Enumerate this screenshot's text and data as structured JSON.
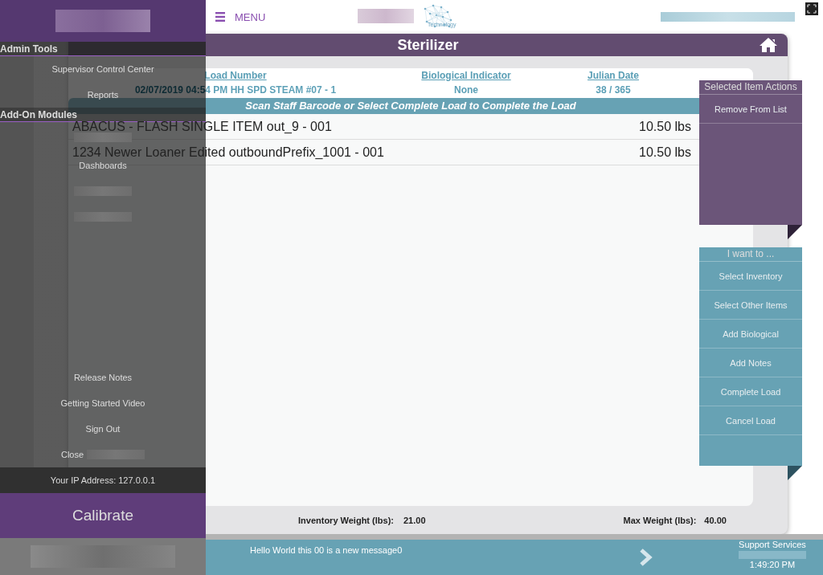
{
  "header": {
    "menu_label": "MENU",
    "logo_text": "Technology"
  },
  "panel": {
    "title": "Sterilizer",
    "columns": [
      {
        "heading": "Load Number",
        "value": "02/07/2019 04:54 PM HH SPD STEAM #07 - 1"
      },
      {
        "heading": "Biological Indicator",
        "value": "None"
      },
      {
        "heading": "Julian Date",
        "value": "38 / 365"
      }
    ],
    "instruction": "Scan Staff Barcode or Select Complete Load to Complete the Load",
    "items": [
      {
        "name": "ABACUS - FLASH SINGLE ITEM out_9 - 001",
        "weight": "10.50 lbs"
      },
      {
        "name": "1234 Newer Loaner Edited outboundPrefix_1001 - 001",
        "weight": "10.50 lbs"
      }
    ],
    "inventory_weight_label": "Inventory Weight (lbs):",
    "inventory_weight": "21.00",
    "max_weight_label": "Max Weight (lbs):",
    "max_weight": "40.00"
  },
  "selected_item_actions": {
    "title": "Selected Item Actions",
    "actions": [
      "Remove From List"
    ]
  },
  "i_want_to": {
    "title": "I want to ...",
    "actions": [
      "Select Inventory",
      "Select Other Items",
      "Add Biological",
      "Add Notes",
      "Complete Load",
      "Cancel Load"
    ]
  },
  "drawer": {
    "sections": [
      {
        "title": "Admin Tools",
        "items": [
          {
            "kind": "link",
            "label": "Supervisor Control Center"
          },
          {
            "kind": "link",
            "label": "Reports"
          }
        ]
      },
      {
        "title": "Add-On Modules",
        "items": [
          {
            "kind": "redacted"
          },
          {
            "kind": "link",
            "label": "Dashboards"
          },
          {
            "kind": "redacted"
          },
          {
            "kind": "redacted"
          }
        ]
      }
    ],
    "footer_items": [
      {
        "kind": "link",
        "label": "Release Notes"
      },
      {
        "kind": "link",
        "label": "Getting Started Video"
      },
      {
        "kind": "link",
        "label": "Sign Out"
      },
      {
        "kind": "link_redacted",
        "label": "Close"
      }
    ],
    "ip_address": "Your IP Address: 127.0.0.1",
    "calibrate_label": "Calibrate"
  },
  "status_bar": {
    "message": "Hello World this 00 is a new message0",
    "support_label": "Support Services",
    "time": "1:49:20 PM"
  }
}
